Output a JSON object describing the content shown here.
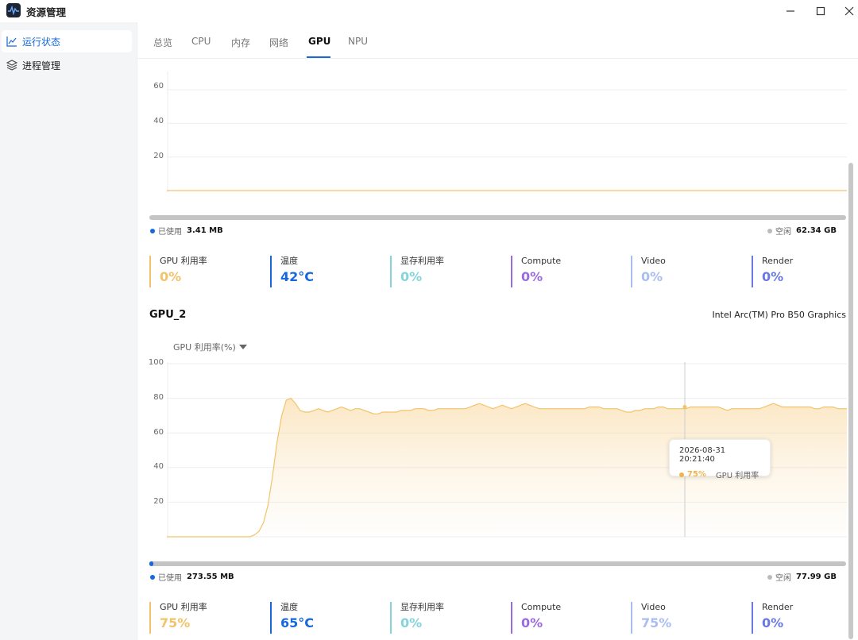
{
  "app": {
    "title": "资源管理",
    "logo_icon": "pulse-logo-icon"
  },
  "window": {
    "minimize_icon": "minimize-icon",
    "maximize_icon": "maximize-icon",
    "close_icon": "close-icon"
  },
  "sidebar": {
    "items": [
      {
        "label": "运行状态",
        "icon": "line-chart-icon",
        "active": true
      },
      {
        "label": "进程管理",
        "icon": "layers-icon",
        "active": false
      }
    ]
  },
  "tabs": [
    {
      "label": "总览"
    },
    {
      "label": "CPU"
    },
    {
      "label": "内存"
    },
    {
      "label": "网络"
    },
    {
      "label": "GPU",
      "active": true
    },
    {
      "label": "NPU"
    }
  ],
  "gpu1": {
    "chart_ticks": [
      "60",
      "40",
      "20"
    ],
    "memory": {
      "used_label": "已使用",
      "used_value": "3.41 MB",
      "free_label": "空闲",
      "free_value": "62.34 GB",
      "used_fraction": 0.0
    },
    "stats": [
      {
        "label": "GPU 利用率",
        "value": "0%",
        "color": "#f2c36b"
      },
      {
        "label": "温度",
        "value": "42°C",
        "color": "#1668dc"
      },
      {
        "label": "显存利用率",
        "value": "0%",
        "color": "#86d3dc"
      },
      {
        "label": "Compute",
        "value": "0%",
        "color": "#9b6be0"
      },
      {
        "label": "Video",
        "value": "0%",
        "color": "#a9bdf0"
      },
      {
        "label": "Render",
        "value": "0%",
        "color": "#6a78e6"
      }
    ]
  },
  "gpu2": {
    "title": "GPU_2",
    "model": "Intel Arc(TM) Pro B50 Graphics",
    "metric_select": "GPU 利用率(%)",
    "chart_ticks": [
      "100",
      "80",
      "60",
      "40",
      "20"
    ],
    "tooltip": {
      "time": "2026-08-31 20:21:40",
      "value": "75%",
      "series": "GPU 利用率"
    },
    "memory": {
      "used_label": "已使用",
      "used_value": "273.55 MB",
      "free_label": "空闲",
      "free_value": "77.99 GB",
      "used_fraction": 0.003
    },
    "stats": [
      {
        "label": "GPU 利用率",
        "value": "75%",
        "color": "#f2c36b"
      },
      {
        "label": "温度",
        "value": "65°C",
        "color": "#1668dc"
      },
      {
        "label": "显存利用率",
        "value": "0%",
        "color": "#86d3dc"
      },
      {
        "label": "Compute",
        "value": "0%",
        "color": "#9b6be0"
      },
      {
        "label": "Video",
        "value": "75%",
        "color": "#a9bdf0"
      },
      {
        "label": "Render",
        "value": "0%",
        "color": "#6a78e6"
      }
    ]
  },
  "chart_data": [
    {
      "type": "line",
      "title": "",
      "ylim": [
        0,
        70
      ],
      "grid": true,
      "series": [
        {
          "values": [
            0,
            0,
            0,
            0,
            0,
            0,
            0,
            0,
            0,
            0
          ]
        }
      ]
    },
    {
      "type": "area",
      "title": "",
      "ylim": [
        0,
        100
      ],
      "grid": true,
      "series": [
        {
          "name": "GPU 利用率",
          "values": [
            0,
            0,
            0,
            0,
            0,
            0,
            0,
            0,
            0,
            0,
            0,
            0,
            0,
            0,
            0,
            0,
            0,
            0,
            0,
            1,
            3,
            8,
            18,
            35,
            55,
            70,
            79,
            80,
            77,
            73,
            72,
            72,
            73,
            74,
            73,
            72,
            73,
            74,
            75,
            74,
            73,
            74,
            74,
            73,
            72,
            71,
            71,
            72,
            72,
            72,
            72,
            73,
            73,
            73,
            74,
            74,
            74,
            73,
            73,
            74,
            74,
            74,
            74,
            74,
            74,
            74,
            75,
            76,
            77,
            76,
            75,
            74,
            75,
            76,
            75,
            74,
            75,
            76,
            77,
            76,
            75,
            74,
            74,
            74,
            74,
            74,
            74,
            74,
            74,
            74,
            74,
            74,
            75,
            75,
            75,
            74,
            74,
            74,
            74,
            73,
            72,
            72,
            73,
            73,
            74,
            74,
            74,
            75,
            75,
            74,
            74,
            74,
            74,
            74,
            75,
            75,
            75,
            75,
            75,
            75,
            75,
            74,
            73,
            74,
            74,
            74,
            74,
            74,
            74,
            74,
            75,
            76,
            77,
            76,
            75,
            75,
            75,
            75,
            75,
            75,
            75,
            74,
            74,
            75,
            75,
            75,
            74,
            74,
            74
          ]
        }
      ]
    }
  ]
}
